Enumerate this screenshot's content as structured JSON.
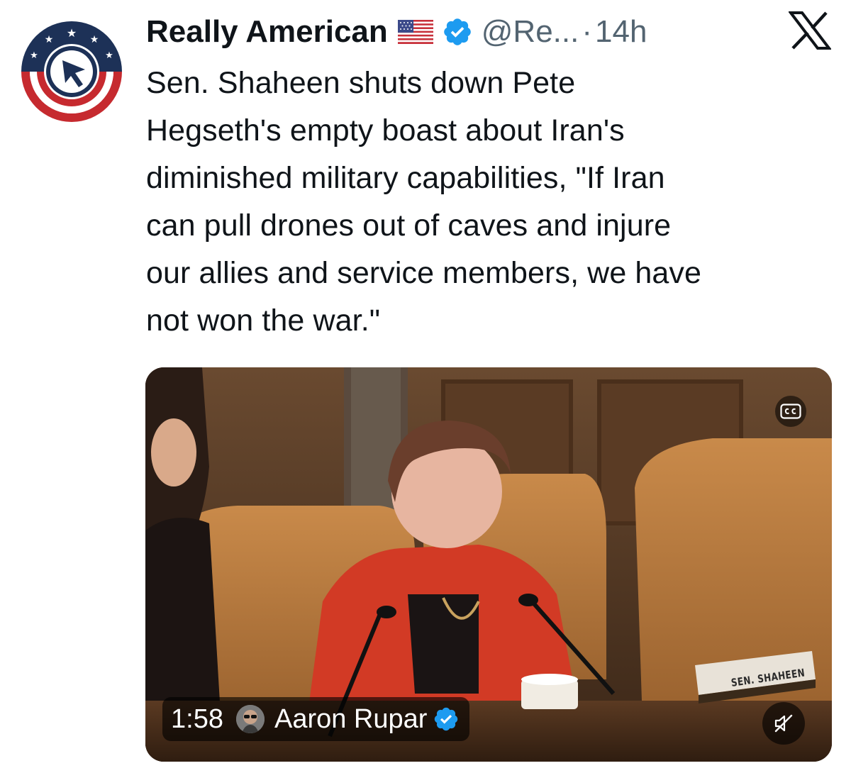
{
  "post": {
    "author": {
      "display_name": "Really American",
      "flag_icon": "us-flag-emoji",
      "verified": true,
      "handle": "@Re...",
      "separator": "·",
      "time": "14h"
    },
    "platform_logo": "x-logo",
    "text": "Sen. Shaheen shuts down Pete\nHegseth's empty boast about Iran's\ndiminished military capabilities, \"If Iran\ncan pull drones out of caves and injure\nour allies and service members, we have\nnot won the war.\"",
    "media": {
      "type": "video",
      "duration": "1:58",
      "uploader": {
        "name": "Aaron Rupar",
        "verified": true
      },
      "name_plate_text": "SEN. SHAHEEN",
      "controls": {
        "captions_icon": "cc-icon",
        "mute_icon": "muted-speaker-icon"
      }
    }
  },
  "colors": {
    "verified_blue": "#1d9bf0",
    "secondary_text": "#536471",
    "primary_text": "#0f1419",
    "logo_red": "#c62a2f",
    "logo_navy": "#1d3157"
  }
}
